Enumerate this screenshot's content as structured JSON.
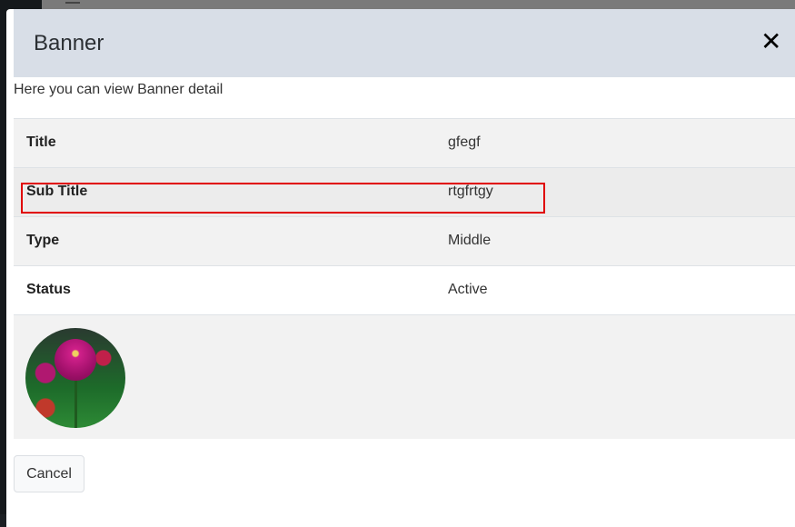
{
  "modal": {
    "title": "Banner",
    "close_icon": "close-icon",
    "description": "Here you can view Banner detail",
    "rows": [
      {
        "label": "Title",
        "value": "gfegf"
      },
      {
        "label": "Sub Title",
        "value": "rtgfrtgy"
      },
      {
        "label": "Type",
        "value": "Middle"
      },
      {
        "label": "Status",
        "value": "Active"
      }
    ],
    "cancel_label": "Cancel",
    "colors": {
      "header_bg": "#d8dee7",
      "highlight": "#e00000"
    }
  }
}
